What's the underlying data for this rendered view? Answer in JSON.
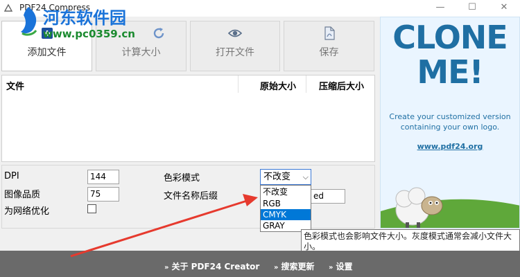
{
  "window": {
    "title": "PDF24 Compress",
    "min_glyph": "—",
    "max_glyph": "☐",
    "close_glyph": "✕"
  },
  "watermark": {
    "title": "河东软件园",
    "url": "www.pc0359.cn"
  },
  "toolbar": {
    "add_label": "添加文件",
    "calc_label": "计算大小",
    "open_label": "打开文件",
    "save_label": "保存"
  },
  "table": {
    "columns": [
      "文件",
      "原始大小",
      "压缩后大小"
    ],
    "rows": []
  },
  "settings": {
    "dpi_label": "DPI",
    "dpi_value": "144",
    "quality_label": "图像品质",
    "quality_value": "75",
    "web_opt_label": "为网络优化",
    "web_opt_checked": false,
    "color_mode_label": "色彩模式",
    "color_mode_value": "不改变",
    "color_mode_options": [
      "不改变",
      "RGB",
      "CMYK",
      "GRAY"
    ],
    "color_mode_highlighted": "CMYK",
    "suffix_label": "文件名称后缀",
    "suffix_value_visible": "ed"
  },
  "tooltip": {
    "text": "色彩模式也会影响文件大小。灰度模式通常会减小文件大小。"
  },
  "ad": {
    "headline_line1": "CLONE",
    "headline_line2": "ME!",
    "text_line1": "Create your customized version",
    "text_line2": "containing your own logo.",
    "link": "www.pdf24.org",
    "colors": {
      "headline": "#1f6fa3",
      "background": "#eaf5ff",
      "grass": "#5fa83a"
    }
  },
  "footer": {
    "about": "关于 PDF24 Creator",
    "search_update": "搜索更新",
    "settings": "设置",
    "arrow_glyph": "»"
  },
  "colors": {
    "accent": "#0078d7",
    "footer_bg": "#6a6a6a",
    "annotation_arrow": "#e63a2e"
  }
}
